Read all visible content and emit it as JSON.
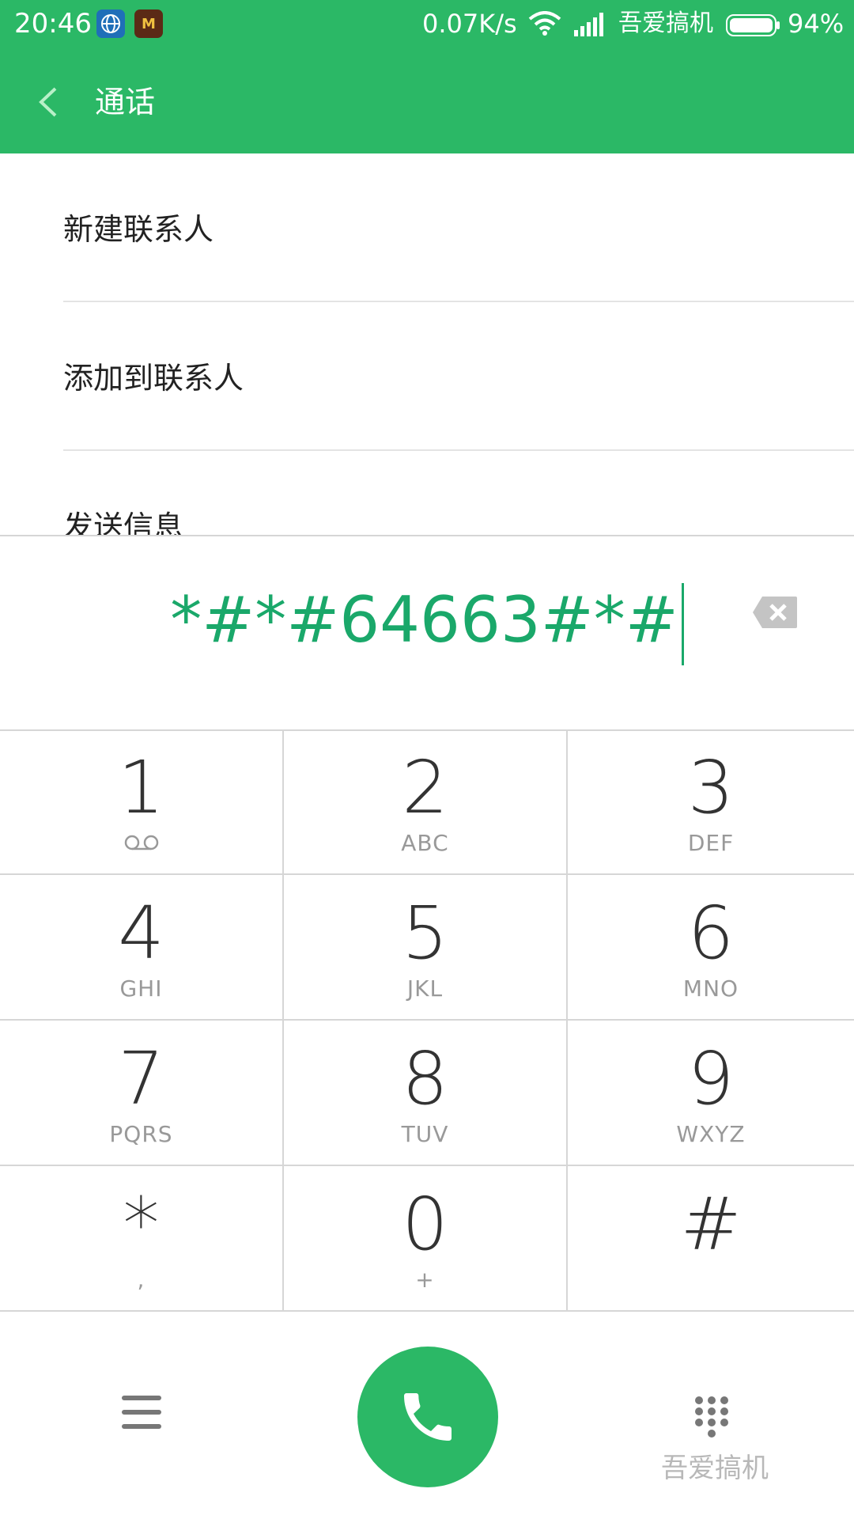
{
  "status_bar": {
    "time": "20:46",
    "net_speed": "0.07K/s",
    "carrier": "吾爱搞机",
    "battery": "94%",
    "game_icon_text": "M"
  },
  "header": {
    "title": "通话"
  },
  "menu": {
    "items": [
      {
        "label": "新建联系人"
      },
      {
        "label": "添加到联系人"
      },
      {
        "label": "发送信息"
      }
    ]
  },
  "dial": {
    "number": "*#*#64663#*#"
  },
  "keypad": {
    "keys": [
      {
        "digit": "1",
        "letters": ""
      },
      {
        "digit": "2",
        "letters": "ABC"
      },
      {
        "digit": "3",
        "letters": "DEF"
      },
      {
        "digit": "4",
        "letters": "GHI"
      },
      {
        "digit": "5",
        "letters": "JKL"
      },
      {
        "digit": "6",
        "letters": "MNO"
      },
      {
        "digit": "7",
        "letters": "PQRS"
      },
      {
        "digit": "8",
        "letters": "TUV"
      },
      {
        "digit": "9",
        "letters": "WXYZ"
      },
      {
        "digit": "*",
        "letters": ","
      },
      {
        "digit": "0",
        "letters": "+"
      },
      {
        "digit": "#",
        "letters": ""
      }
    ]
  },
  "watermark": "吾爱搞机",
  "colors": {
    "accent": "#2bb866",
    "dial_text": "#1aa86a"
  }
}
